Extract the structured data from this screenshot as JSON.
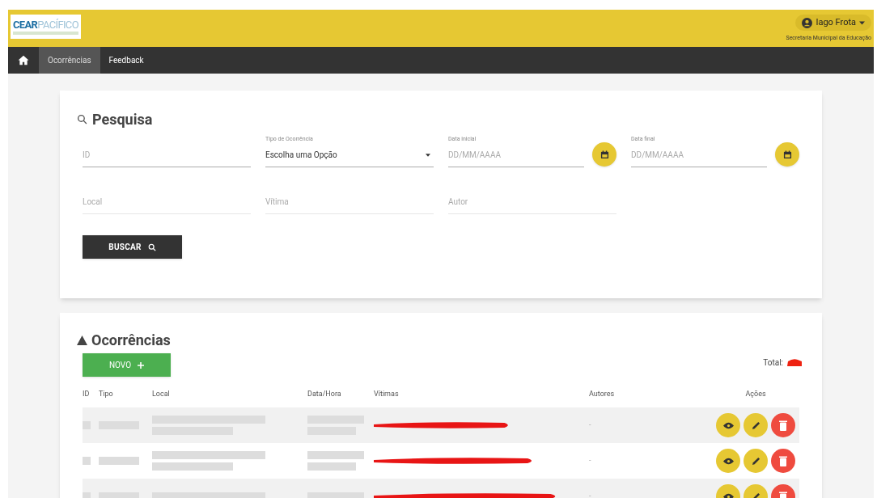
{
  "header": {
    "logo": {
      "part_1": "CEAR",
      "part_2": "PACÍFICO"
    },
    "user": {
      "name": "Iago Frota",
      "organization": "Secretaria Municipal da Educação"
    }
  },
  "nav": {
    "items": [
      {
        "label": "Ocorrências",
        "selected": true
      },
      {
        "label": "Feedback",
        "selected": false
      }
    ]
  },
  "search": {
    "title": "Pesquisa",
    "fields": [
      {
        "kind": "text",
        "placeholder": "ID"
      },
      {
        "kind": "select",
        "label": "Tipo de Ocorrência",
        "value": "Escolha uma Opção"
      },
      {
        "kind": "date",
        "label": "Data inicial",
        "placeholder": "DD/MM/AAAA"
      },
      {
        "kind": "date",
        "label": "Data final",
        "placeholder": "DD/MM/AAAA"
      },
      {
        "kind": "text",
        "placeholder": "Local"
      },
      {
        "kind": "text",
        "placeholder": "Vítima"
      },
      {
        "kind": "text",
        "placeholder": "Autor"
      }
    ],
    "button": "BUSCAR"
  },
  "results": {
    "title": "Ocorrências",
    "new_button": "NOVO",
    "total_label": "Total:",
    "table": {
      "columns": [
        "ID",
        "Tipo",
        "Local",
        "Data/Hora",
        "Vítimas",
        "Autores",
        "Ações"
      ],
      "rows": [
        {
          "autores": "-"
        },
        {
          "autores": "-"
        },
        {
          "autores": "-"
        }
      ]
    }
  }
}
